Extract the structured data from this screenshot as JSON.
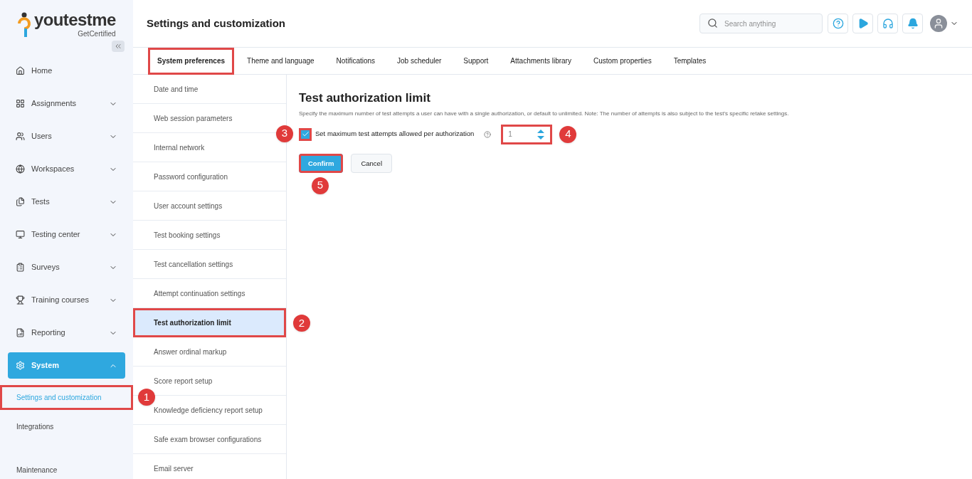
{
  "logo": {
    "name": "youtestme",
    "tagline": "GetCertified"
  },
  "page_title": "Settings and customization",
  "search": {
    "placeholder": "Search anything"
  },
  "nav": [
    {
      "label": "Home",
      "expandable": false,
      "active": false
    },
    {
      "label": "Assignments",
      "expandable": true,
      "active": false
    },
    {
      "label": "Users",
      "expandable": true,
      "active": false
    },
    {
      "label": "Workspaces",
      "expandable": true,
      "active": false
    },
    {
      "label": "Tests",
      "expandable": true,
      "active": false
    },
    {
      "label": "Testing center",
      "expandable": true,
      "active": false
    },
    {
      "label": "Surveys",
      "expandable": true,
      "active": false
    },
    {
      "label": "Training courses",
      "expandable": true,
      "active": false
    },
    {
      "label": "Reporting",
      "expandable": true,
      "active": false
    },
    {
      "label": "System",
      "expandable": true,
      "active": true,
      "expanded": true,
      "children": [
        {
          "label": "Settings and customization",
          "selected": true,
          "highlighted": true,
          "callout": "1"
        },
        {
          "label": "Integrations",
          "selected": false,
          "highlighted": false
        },
        {
          "label": "Maintenance",
          "selected": false,
          "highlighted": false
        }
      ]
    }
  ],
  "tabs": [
    {
      "label": "System preferences",
      "selected": true,
      "highlighted": true
    },
    {
      "label": "Theme and language",
      "selected": false,
      "highlighted": false
    },
    {
      "label": "Notifications",
      "selected": false,
      "highlighted": false
    },
    {
      "label": "Job scheduler",
      "selected": false,
      "highlighted": false
    },
    {
      "label": "Support",
      "selected": false,
      "highlighted": false
    },
    {
      "label": "Attachments library",
      "selected": false,
      "highlighted": false
    },
    {
      "label": "Custom properties",
      "selected": false,
      "highlighted": false
    },
    {
      "label": "Templates",
      "selected": false,
      "highlighted": false
    }
  ],
  "settings": [
    {
      "label": "Date and time",
      "selected": false,
      "highlighted": false
    },
    {
      "label": "Web session parameters",
      "selected": false,
      "highlighted": false
    },
    {
      "label": "Internal network",
      "selected": false,
      "highlighted": false
    },
    {
      "label": "Password configuration",
      "selected": false,
      "highlighted": false
    },
    {
      "label": "User account settings",
      "selected": false,
      "highlighted": false
    },
    {
      "label": "Test booking settings",
      "selected": false,
      "highlighted": false
    },
    {
      "label": "Test cancellation settings",
      "selected": false,
      "highlighted": false
    },
    {
      "label": "Attempt continuation settings",
      "selected": false,
      "highlighted": false
    },
    {
      "label": "Test authorization limit",
      "selected": true,
      "highlighted": true,
      "callout": "2"
    },
    {
      "label": "Answer ordinal markup",
      "selected": false,
      "highlighted": false
    },
    {
      "label": "Score report setup",
      "selected": false,
      "highlighted": false
    },
    {
      "label": "Knowledge deficiency report setup",
      "selected": false,
      "highlighted": false
    },
    {
      "label": "Safe exam browser configurations",
      "selected": false,
      "highlighted": false
    },
    {
      "label": "Email server",
      "selected": false,
      "highlighted": false
    }
  ],
  "panel": {
    "title": "Test authorization limit",
    "description": "Specify the maximum number of test attempts a user can have with a single authorization, or default to unlimited. Note: The number of attempts is also subject to the test's specific retake settings.",
    "checkbox": {
      "label": "Set maximum test attempts allowed per authorization",
      "checked": true,
      "highlighted": true,
      "callout": "3"
    },
    "attempts": {
      "value": "1",
      "highlighted": true,
      "callout": "4"
    },
    "buttons": [
      {
        "label": "Confirm",
        "kind": "primary",
        "highlighted": true,
        "callout": "5"
      },
      {
        "label": "Cancel",
        "kind": "secondary",
        "highlighted": false
      }
    ]
  }
}
